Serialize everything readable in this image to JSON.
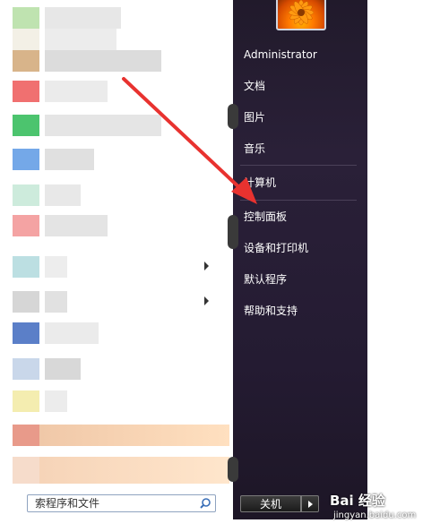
{
  "user": {
    "name": "Administrator"
  },
  "right_menu": {
    "documents": "文档",
    "pictures": "图片",
    "music": "音乐",
    "computer": "计算机",
    "control_panel": "控制面板",
    "devices_printers": "设备和打印机",
    "default_programs": "默认程序",
    "help_support": "帮助和支持"
  },
  "search": {
    "placeholder": "索程序和文件"
  },
  "shutdown": {
    "label": "关机"
  },
  "watermark": {
    "main": "Bai 经验",
    "sub": "jingyan.baidu.com"
  },
  "icons": {
    "search": "search-icon",
    "shutdown_arrow": "chevron-right-icon",
    "submenu_arrow": "chevron-right-icon",
    "avatar": "flower-avatar-icon",
    "annotation": "red-arrow-annotation"
  },
  "colors": {
    "right_panel": "#2a2038",
    "annotation": "#e8322f",
    "menu_text": "#ffffff"
  }
}
